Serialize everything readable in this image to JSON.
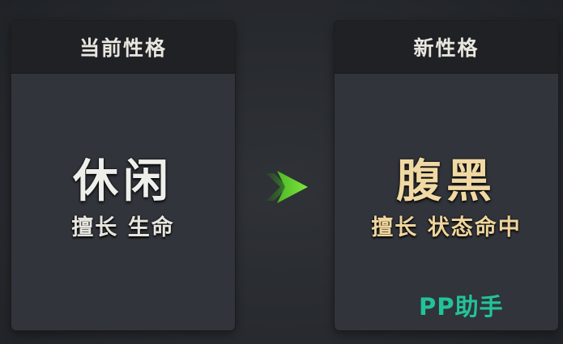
{
  "current": {
    "header": "当前性格",
    "trait": "休闲",
    "desc": "擅长 生命"
  },
  "new": {
    "header": "新性格",
    "trait": "腹黑",
    "desc": "擅长 状态命中"
  },
  "arrow_icon": "double-chevron-right-icon",
  "watermark": {
    "text": "PP助手",
    "color": "#22c39a"
  },
  "colors": {
    "current_trait": "#eeeeea",
    "new_trait": "#f1d9a4",
    "arrow": "#5fd12e"
  }
}
